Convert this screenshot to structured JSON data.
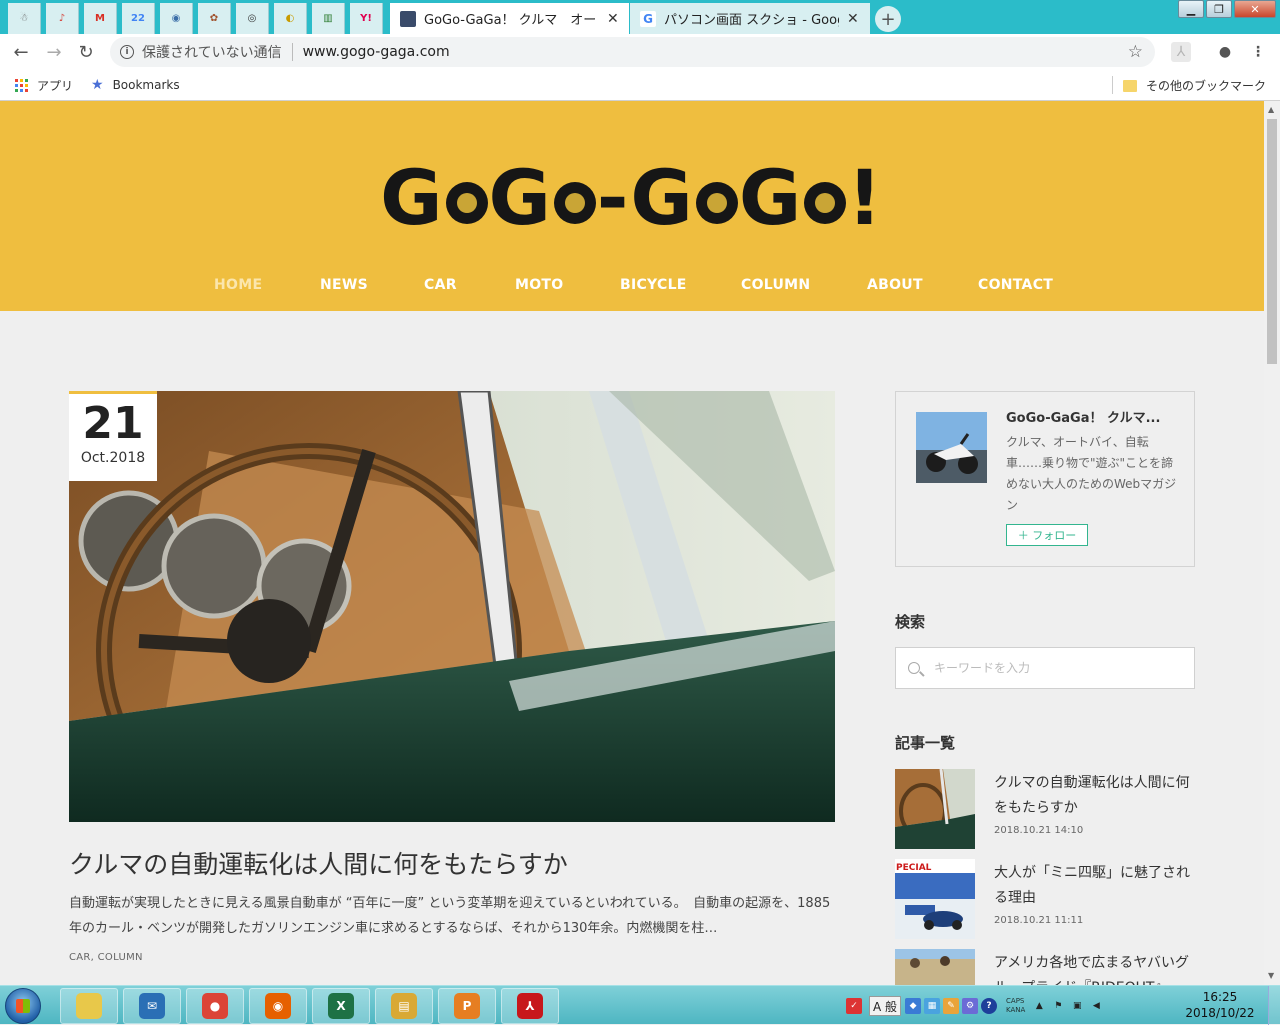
{
  "browser": {
    "pinned_tabs": [
      {
        "icon": "pinned-site-icon",
        "glyph": "☃",
        "color": "#666666"
      },
      {
        "icon": "music-icon",
        "glyph": "♪",
        "color": "#d6453c"
      },
      {
        "icon": "gmail-icon",
        "glyph": "M",
        "color": "#d93025"
      },
      {
        "icon": "calendar-icon",
        "glyph": "22",
        "color": "#4285f4"
      },
      {
        "icon": "globe-icon",
        "glyph": "◉",
        "color": "#3b6ea8"
      },
      {
        "icon": "paw-icon",
        "glyph": "✿",
        "color": "#a0522d"
      },
      {
        "icon": "record-icon",
        "glyph": "◎",
        "color": "#333333"
      },
      {
        "icon": "cat-icon",
        "glyph": "◐",
        "color": "#c89b00"
      },
      {
        "icon": "chart-icon",
        "glyph": "▥",
        "color": "#2e7d32"
      },
      {
        "icon": "yahoo-icon",
        "glyph": "Y!",
        "color": "#e0004e"
      }
    ],
    "active_tab": {
      "title": "GoGo-GaGa！ クルマ　オートバ",
      "close": "✕"
    },
    "inactive_tab": {
      "title": "パソコン画面 スクショ - Google 検",
      "close": "✕"
    },
    "new_tab": "+",
    "window_buttons": {
      "minimize": "▁",
      "maximize": "❐",
      "close": "✕"
    },
    "nav": {
      "back": "←",
      "forward": "→",
      "reload": "↻"
    },
    "omnibox": {
      "security_label": "保護されていない通信",
      "url": "www.gogo-gaga.com",
      "info": "i",
      "star": "☆"
    },
    "extensions": {
      "acrobat": "⅄",
      "account": "●",
      "menu": "⋮"
    },
    "bookmarks": {
      "apps_label": "アプリ",
      "bookmarks_label": "Bookmarks",
      "other_label": "その他のブックマーク"
    }
  },
  "site": {
    "logo_parts": [
      "G",
      "G",
      "-G",
      "G",
      "!"
    ],
    "logo_text": "GoGo-GaGa!",
    "nav": [
      "HOME",
      "NEWS",
      "CAR",
      "MOTO",
      "BICYCLE",
      "COLUMN",
      "ABOUT",
      "CONTACT"
    ],
    "current_nav": "HOME",
    "colors": {
      "brand_yellow": "#efbe3f",
      "accent_green": "#33b58f"
    }
  },
  "post": {
    "day": "21",
    "month_year": "Oct.2018",
    "title": "クルマの自動運転化は人間に何をもたらすか",
    "excerpt": "自動運転が実現したときに見える風景自動車が “百年に一度” という変革期を迎えているといわれている。　自動車の起源を、1885年のカール・ベンツが開発したガソリンエンジン車に求めるとするならば、それから130年余。内燃機関を柱…",
    "categories": "CAR, COLUMN"
  },
  "sidebar": {
    "profile": {
      "name": "GoGo-GaGa！ クルマ...",
      "description": "クルマ、オートバイ、自転車……乗り物で\"遊ぶ\"ことを諦めない大人のためのWebマガジン",
      "follow_label": "＋ フォロー"
    },
    "search": {
      "heading": "検索",
      "placeholder": "キーワードを入力"
    },
    "articles": {
      "heading": "記事一覧",
      "items": [
        {
          "title": "クルマの自動運転化は人間に何をもたらすか",
          "date": "2018.10.21 14:10"
        },
        {
          "title": "大人が「ミニ四駆」に魅了される理由",
          "date": "2018.10.21 11:11",
          "thumb_label": "PECIAL"
        },
        {
          "title": "アメリカ各地で広まるヤバいグループライド『RIDEOUT』"
        }
      ]
    }
  },
  "taskbar": {
    "apps": [
      {
        "icon": "explorer-folder-icon",
        "glyph": "",
        "color": "#e8c84a"
      },
      {
        "icon": "thunderbird-icon",
        "glyph": "✉",
        "color": "#2a6fb5"
      },
      {
        "icon": "chrome-icon",
        "glyph": "●",
        "color": "#db4437"
      },
      {
        "icon": "firefox-icon",
        "glyph": "◉",
        "color": "#e66000"
      },
      {
        "icon": "excel-icon",
        "glyph": "X",
        "color": "#1e7145"
      },
      {
        "icon": "file-manager-icon",
        "glyph": "▤",
        "color": "#d9a935"
      },
      {
        "icon": "pdf-reader-icon",
        "glyph": "P",
        "color": "#e67e22"
      },
      {
        "icon": "acrobat-icon",
        "glyph": "⅄",
        "color": "#c7171b"
      }
    ],
    "ime_label": "A 般",
    "caps": "CAPS",
    "kana": "KANA",
    "time": "16:25",
    "date": "2018/10/22"
  }
}
